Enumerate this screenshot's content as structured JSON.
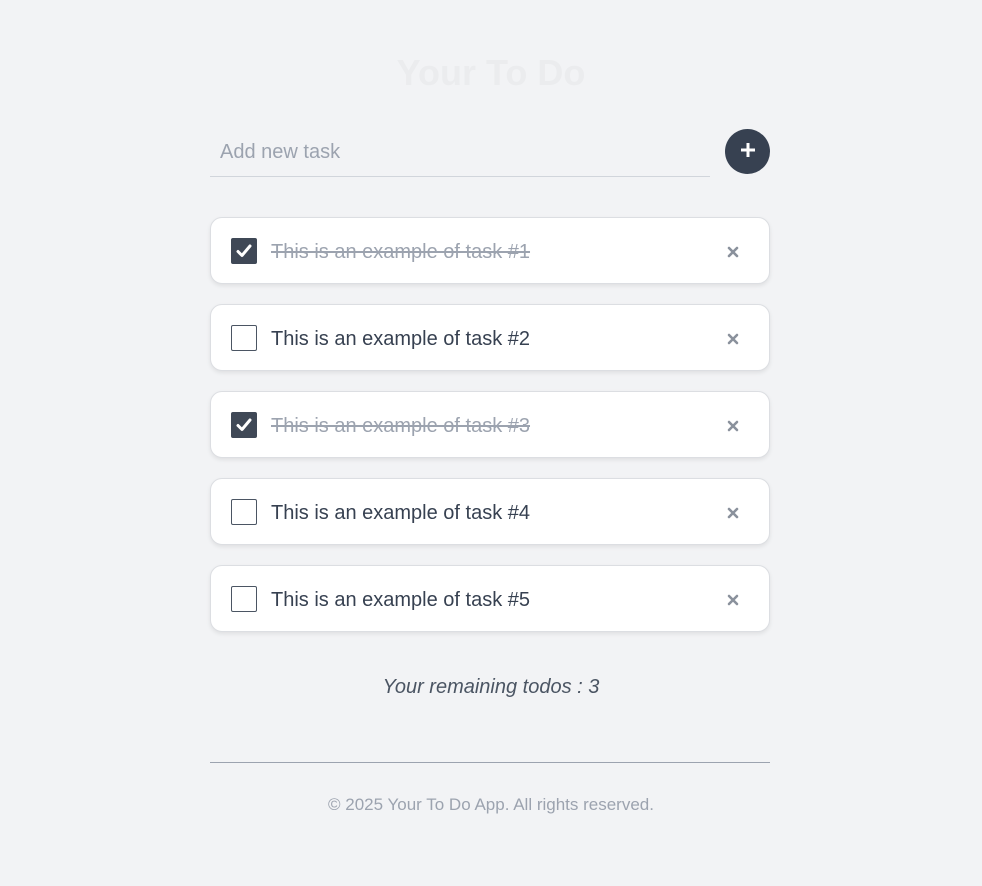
{
  "app": {
    "title": "Your To Do"
  },
  "add_task": {
    "placeholder": "Add new task",
    "value": "",
    "button_icon": "plus-icon"
  },
  "tasks": [
    {
      "text": "This is an example of task #1",
      "completed": true
    },
    {
      "text": "This is an example of task #2",
      "completed": false
    },
    {
      "text": "This is an example of task #3",
      "completed": true
    },
    {
      "text": "This is an example of task #4",
      "completed": false
    },
    {
      "text": "This is an example of task #5",
      "completed": false
    }
  ],
  "summary": {
    "remaining_text": "Your remaining todos : 3"
  },
  "footer": {
    "copyright": "© 2025 Your To Do App. All rights reserved."
  },
  "colors": {
    "background": "#f2f3f5",
    "accent": "#374151",
    "checked": "#3f4856",
    "muted": "#9ca3af"
  }
}
